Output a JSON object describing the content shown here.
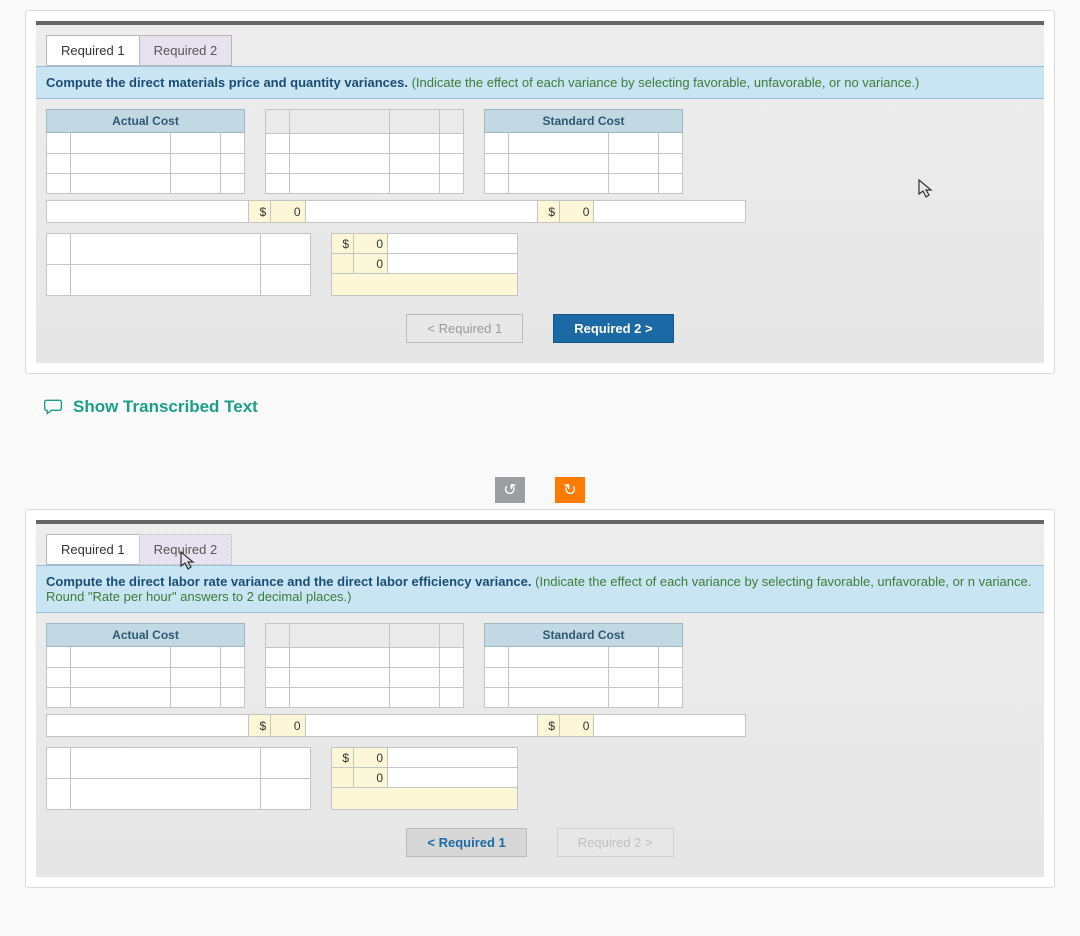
{
  "panel1": {
    "tabs": {
      "t1": "Required 1",
      "t2": "Required 2"
    },
    "instruction_bold": "Compute the direct materials price and quantity variances.",
    "instruction_hint": "(Indicate the effect of each variance by selecting favorable, unfavorable, or no variance.)",
    "headers": {
      "actual": "Actual Cost",
      "standard": "Standard Cost"
    },
    "totals": {
      "sym1": "$",
      "v1": "0",
      "sym2": "$",
      "v2": "0"
    },
    "sub": {
      "sym": "$",
      "r1": "0",
      "r2": "0"
    },
    "nav": {
      "prev": "< Required 1",
      "next": "Required 2  >"
    }
  },
  "show_text": "Show Transcribed Text",
  "controls": {
    "undo": "↺",
    "redo": "↻"
  },
  "panel2": {
    "tabs": {
      "t1": "Required 1",
      "t2": "Required 2"
    },
    "instruction_bold": "Compute the direct labor rate variance and the direct labor efficiency variance.",
    "instruction_hint": "(Indicate the effect of each variance by selecting favorable, unfavorable, or n variance. Round \"Rate per hour\" answers to 2 decimal places.)",
    "headers": {
      "actual": "Actual Cost",
      "standard": "Standard Cost"
    },
    "totals": {
      "sym1": "$",
      "v1": "0",
      "sym2": "$",
      "v2": "0"
    },
    "sub": {
      "sym": "$",
      "r1": "0",
      "r2": "0"
    },
    "nav": {
      "prev": "<  Required 1",
      "next": "Required 2  >"
    }
  }
}
